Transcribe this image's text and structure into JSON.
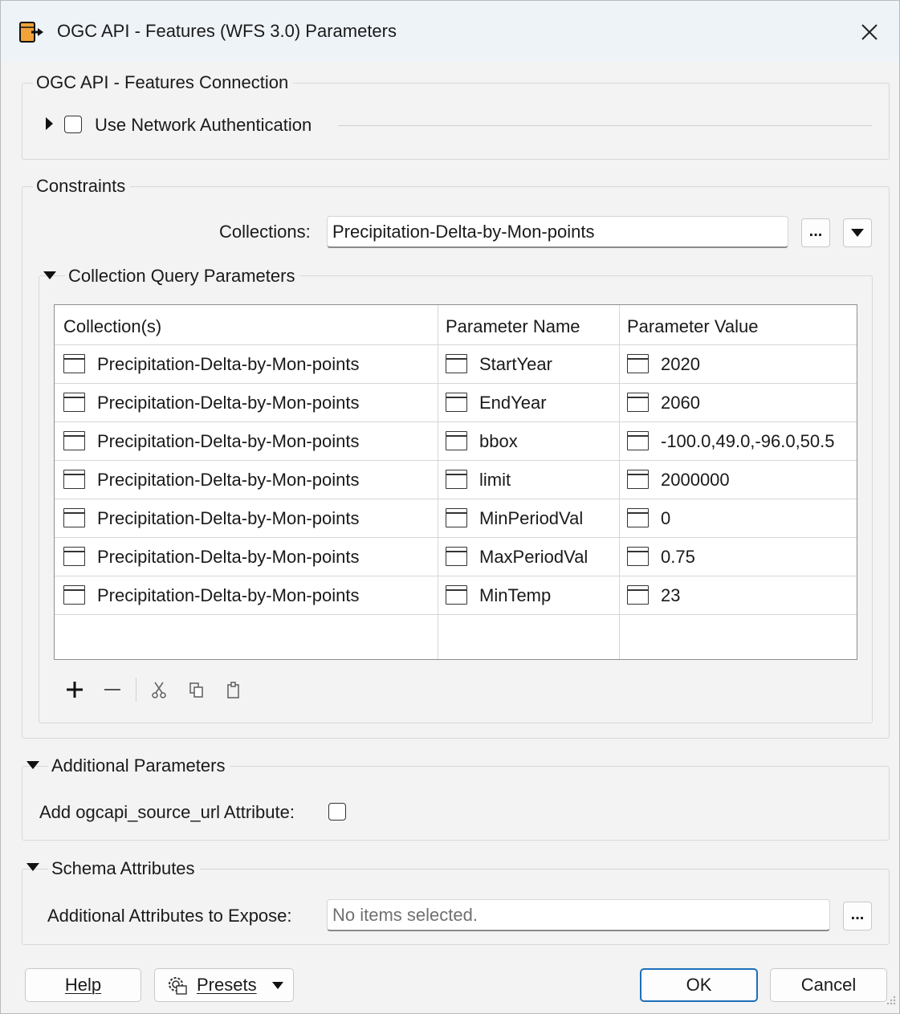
{
  "window": {
    "title": "OGC API - Features (WFS 3.0) Parameters",
    "icon": "ogc-api-reader-icon"
  },
  "connection": {
    "group_label": "OGC API - Features Connection",
    "network_auth_label": "Use Network Authentication",
    "network_auth_checked": false
  },
  "constraints": {
    "group_label": "Constraints",
    "collections_label": "Collections:",
    "collections_value": "Precipitation-Delta-by-Mon-points",
    "browse_label": "...",
    "query_params": {
      "group_label": "Collection Query Parameters",
      "columns": [
        "Collection(s)",
        "Parameter Name",
        "Parameter Value"
      ],
      "rows": [
        {
          "collection": "Precipitation-Delta-by-Mon-points",
          "name": "StartYear",
          "value": "2020"
        },
        {
          "collection": "Precipitation-Delta-by-Mon-points",
          "name": "EndYear",
          "value": "2060"
        },
        {
          "collection": "Precipitation-Delta-by-Mon-points",
          "name": "bbox",
          "value": "-100.0,49.0,-96.0,50.5"
        },
        {
          "collection": "Precipitation-Delta-by-Mon-points",
          "name": "limit",
          "value": "2000000"
        },
        {
          "collection": "Precipitation-Delta-by-Mon-points",
          "name": "MinPeriodVal",
          "value": "0"
        },
        {
          "collection": "Precipitation-Delta-by-Mon-points",
          "name": "MaxPeriodVal",
          "value": "0.75"
        },
        {
          "collection": "Precipitation-Delta-by-Mon-points",
          "name": "MinTemp",
          "value": "23"
        }
      ]
    }
  },
  "additional": {
    "group_label": "Additional Parameters",
    "source_url_label": "Add ogcapi_source_url Attribute:",
    "source_url_checked": false
  },
  "schema": {
    "group_label": "Schema Attributes",
    "expose_label": "Additional Attributes to Expose:",
    "expose_placeholder": "No items selected.",
    "browse_label": "..."
  },
  "footer": {
    "help_label": "Help",
    "presets_label": "Presets",
    "ok_label": "OK",
    "cancel_label": "Cancel"
  },
  "colors": {
    "accent": "#1d6fb8",
    "dialog_bg": "#f3f3f3",
    "titlebar_bg": "#eef3f8"
  }
}
